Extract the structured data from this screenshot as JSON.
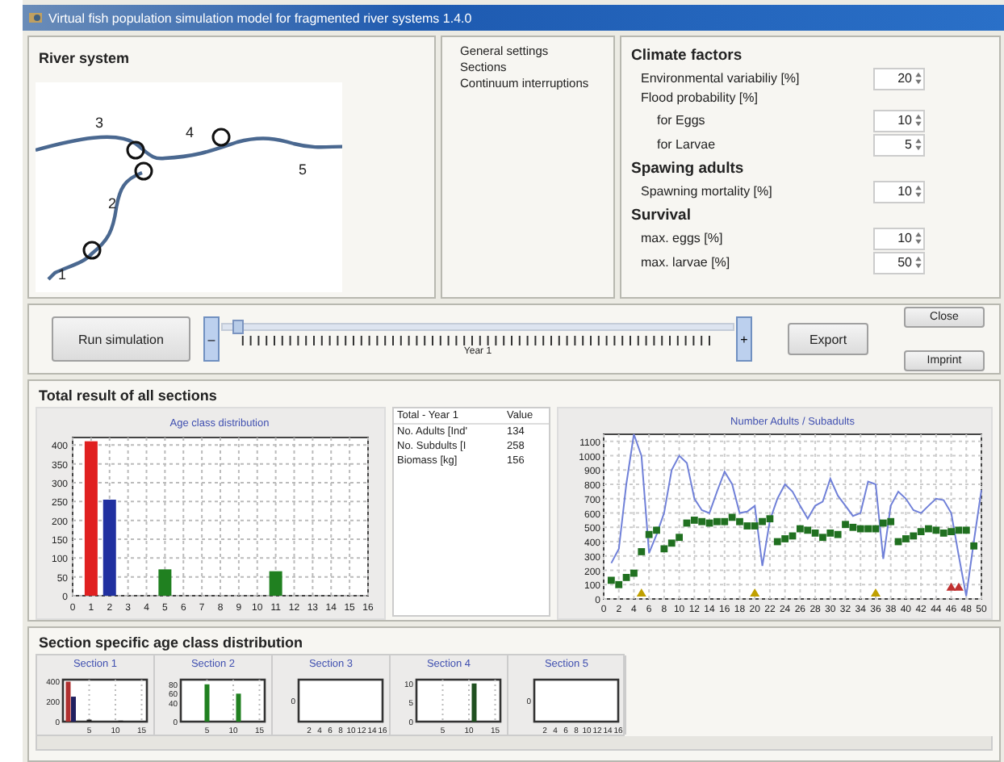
{
  "window": {
    "title": "Virtual fish population simulation model for fragmented river systems 1.4.0"
  },
  "river_system": {
    "title": "River system",
    "section_labels": [
      "1",
      "2",
      "3",
      "4",
      "5"
    ]
  },
  "tree": {
    "items": [
      {
        "label": "General settings"
      },
      {
        "label": "Sections"
      },
      {
        "label": "Continuum interruptions"
      }
    ]
  },
  "settings": [
    {
      "kind": "heading",
      "label": "Climate factors"
    },
    {
      "kind": "spin",
      "label": "Environmental variabiliy [%]",
      "value": "20"
    },
    {
      "kind": "label",
      "label": "Flood probability [%]"
    },
    {
      "kind": "spin_sub",
      "label": "for Eggs",
      "value": "10"
    },
    {
      "kind": "spin_sub",
      "label": "for Larvae",
      "value": "5"
    },
    {
      "kind": "heading",
      "label": "Spawing adults"
    },
    {
      "kind": "spin",
      "label": "Spawning mortality [%]",
      "value": "10"
    },
    {
      "kind": "heading",
      "label": "Survival"
    },
    {
      "kind": "spin",
      "label": "max. eggs [%]",
      "value": "10"
    },
    {
      "kind": "spin",
      "label": "max. larvae [%]",
      "value": "50"
    }
  ],
  "controls": {
    "run": "Run simulation",
    "minus": "–",
    "plus": "+",
    "year": {
      "label": "Year 1",
      "level": 0.02
    },
    "export": "Export",
    "close": "Close",
    "imprint": "Imprint"
  },
  "total": {
    "title": "Total result of all sections",
    "bar_chart": {
      "chart_data": {
        "type": "bar",
        "grid": true,
        "title": "Age class distribution",
        "x": [
          1,
          2,
          5,
          11
        ],
        "values": [
          410,
          255,
          70,
          65
        ],
        "colors": [
          "#e02020",
          "#2030a0",
          "#208020",
          "#208020"
        ],
        "xlim": [
          0,
          16
        ],
        "ylim": [
          0,
          420
        ],
        "xticks": [
          0,
          1,
          2,
          3,
          4,
          5,
          6,
          7,
          8,
          9,
          10,
          11,
          12,
          13,
          14,
          15,
          16
        ],
        "yticks": [
          0,
          50,
          100,
          150,
          200,
          250,
          300,
          350,
          400
        ]
      }
    },
    "table": {
      "columns": [
        "Total - Year 1",
        "Value"
      ],
      "rows": [
        [
          "No. Adults [Ind'",
          "134"
        ],
        [
          "No. Subdults [I",
          "258"
        ],
        [
          "Biomass [kg]",
          "156"
        ]
      ]
    },
    "line_chart": {
      "chart_data": {
        "type": "line",
        "grid": true,
        "title": "Number Adults / Subadults",
        "x": [
          1,
          2,
          3,
          4,
          5,
          6,
          7,
          8,
          9,
          10,
          11,
          12,
          13,
          14,
          15,
          16,
          17,
          18,
          19,
          20,
          21,
          22,
          23,
          24,
          25,
          26,
          27,
          28,
          29,
          30,
          31,
          32,
          33,
          34,
          35,
          36,
          37,
          38,
          39,
          40,
          41,
          42,
          43,
          44,
          45,
          46,
          47,
          48,
          49,
          50
        ],
        "xlim": [
          0,
          50
        ],
        "ylim": [
          0,
          1150
        ],
        "xticks": [
          0,
          2,
          4,
          6,
          8,
          10,
          12,
          14,
          16,
          18,
          20,
          22,
          24,
          26,
          28,
          30,
          32,
          34,
          36,
          38,
          40,
          42,
          44,
          46,
          48,
          50
        ],
        "yticks": [
          0,
          100,
          200,
          300,
          400,
          500,
          600,
          700,
          800,
          900,
          1000,
          1100
        ],
        "series": [
          {
            "color": "#7080d8",
            "values": [
              250,
              350,
              800,
              1150,
              1000,
              320,
              450,
              600,
              900,
              1000,
              950,
              700,
              620,
              600,
              750,
              890,
              800,
              600,
              610,
              650,
              230,
              550,
              700,
              800,
              750,
              650,
              560,
              650,
              680,
              840,
              720,
              650,
              580,
              600,
              820,
              800,
              280,
              650,
              750,
              700,
              620,
              600,
              650,
              700,
              690,
              600,
              300,
              20,
              400,
              760
            ]
          },
          {
            "type": "scatter",
            "marker": "square",
            "color": "#207020",
            "values": [
              130,
              100,
              150,
              180,
              330,
              450,
              480,
              350,
              390,
              430,
              530,
              550,
              540,
              530,
              540,
              540,
              570,
              540,
              510,
              510,
              540,
              560,
              400,
              420,
              440,
              490,
              480,
              460,
              430,
              460,
              450,
              520,
              500,
              490,
              490,
              490,
              530,
              540,
              400,
              420,
              440,
              470,
              490,
              480,
              460,
              470,
              480,
              480,
              370,
              null
            ]
          },
          {
            "type": "scatter",
            "marker": "triangle",
            "color": "#c0a000",
            "values": [
              null,
              null,
              null,
              null,
              40,
              null,
              null,
              null,
              null,
              null,
              null,
              null,
              null,
              null,
              null,
              null,
              null,
              null,
              null,
              40,
              null,
              null,
              null,
              null,
              null,
              null,
              null,
              null,
              null,
              null,
              null,
              null,
              null,
              null,
              null,
              40,
              null,
              null,
              null,
              null,
              null,
              null,
              null,
              null,
              null,
              null,
              null,
              null,
              null,
              null
            ]
          },
          {
            "type": "scatter",
            "marker": "triangle",
            "color": "#c03030",
            "values": [
              null,
              null,
              null,
              null,
              null,
              null,
              null,
              null,
              null,
              null,
              null,
              null,
              null,
              null,
              null,
              null,
              null,
              null,
              null,
              null,
              null,
              null,
              null,
              null,
              null,
              null,
              null,
              null,
              null,
              null,
              null,
              null,
              null,
              null,
              null,
              null,
              null,
              null,
              null,
              null,
              null,
              null,
              null,
              null,
              null,
              80,
              80,
              null,
              null,
              null
            ]
          }
        ]
      }
    }
  },
  "sections": {
    "title": "Section specific age class distribution",
    "charts": [
      {
        "chart_data": {
          "type": "bar",
          "grid": true,
          "title": "Section 1",
          "x": [
            1,
            2,
            5,
            11
          ],
          "values": [
            400,
            250,
            20,
            10
          ],
          "colors": [
            "#b03030",
            "#202060",
            "#202020",
            "#202020"
          ],
          "xlim": [
            0,
            16
          ],
          "ylim": [
            0,
            420
          ],
          "xticks": [
            5,
            10,
            15
          ],
          "yticks": [
            0,
            200,
            400
          ]
        }
      },
      {
        "chart_data": {
          "type": "bar",
          "grid": true,
          "title": "Section 2",
          "x": [
            5,
            11
          ],
          "values": [
            80,
            60
          ],
          "colors": [
            "#208020",
            "#208020"
          ],
          "xlim": [
            0,
            16
          ],
          "ylim": [
            0,
            90
          ],
          "xticks": [
            5,
            10,
            15
          ],
          "yticks": [
            0,
            40,
            60,
            80
          ]
        }
      },
      {
        "kind": "empty",
        "title": "Section 3",
        "y_labels": [
          "0"
        ],
        "x_labels": [
          "2",
          "4",
          "6",
          "8",
          "10",
          "12",
          "14",
          "16"
        ]
      },
      {
        "chart_data": {
          "type": "bar",
          "grid": true,
          "title": "Section 4",
          "x": [
            11
          ],
          "values": [
            10
          ],
          "colors": [
            "#205020"
          ],
          "xlim": [
            0,
            16
          ],
          "ylim": [
            0,
            11
          ],
          "xticks": [
            5,
            10,
            15
          ],
          "yticks": [
            0,
            5,
            10
          ]
        }
      },
      {
        "kind": "empty",
        "title": "Section 5",
        "y_labels": [
          "0"
        ],
        "x_labels": [
          "2",
          "4",
          "6",
          "8",
          "10",
          "12",
          "14",
          "16"
        ]
      }
    ]
  }
}
